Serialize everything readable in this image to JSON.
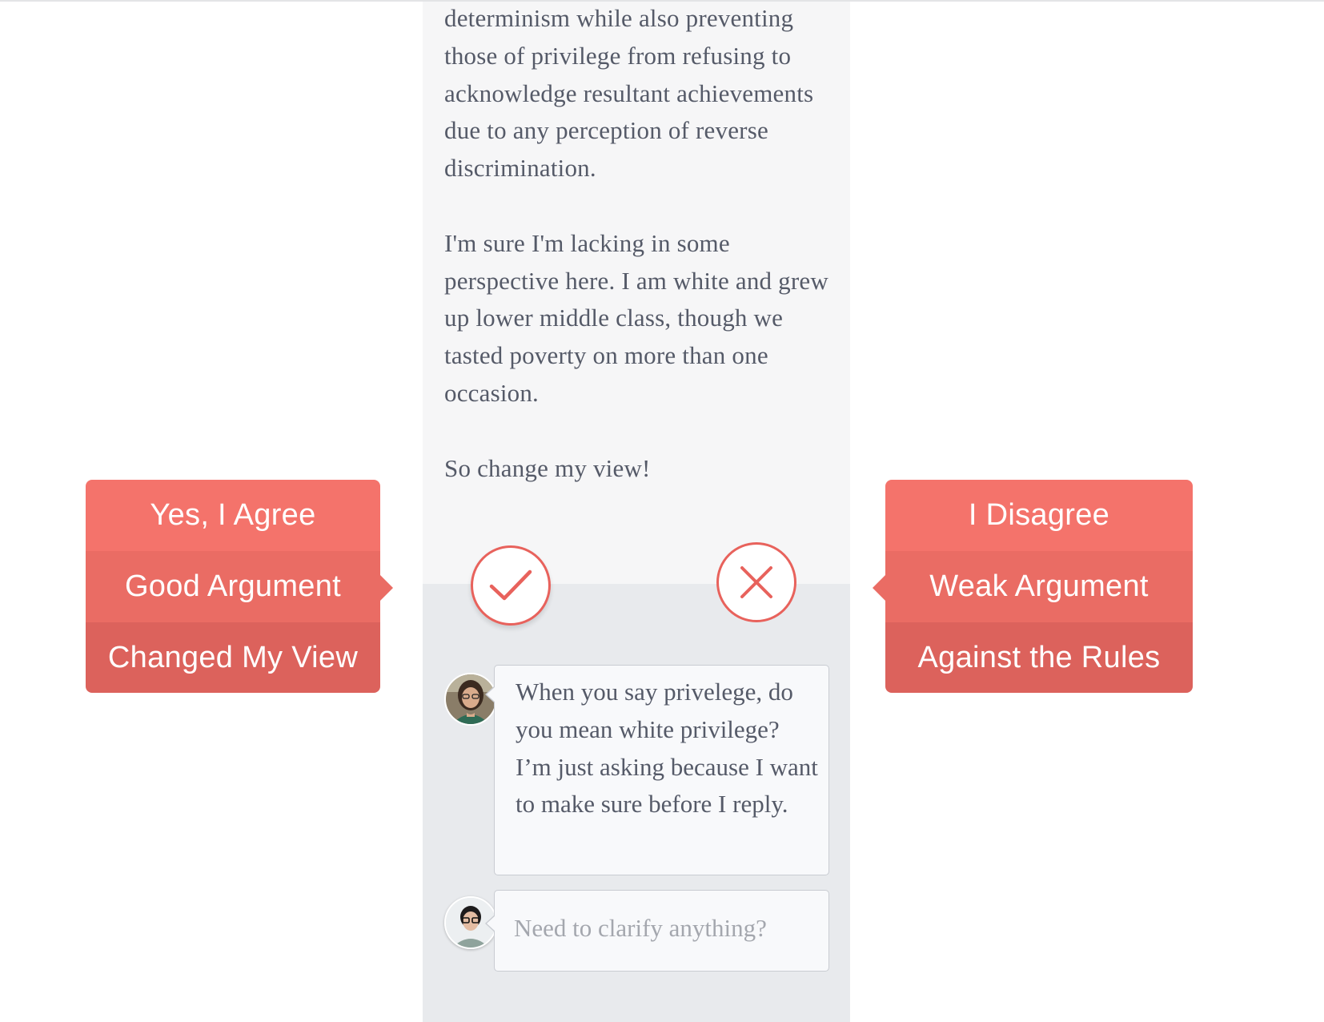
{
  "post": {
    "paragraphs": [
      "determinism while also preventing those of privilege from refusing to acknowledge resultant achievements due to any perception of reverse discrimination.",
      "I'm sure I'm lacking in some perspective here. I am white and grew up lower middle class, though we tasted poverty on more than one occasion.",
      "So change my view!"
    ]
  },
  "vote": {
    "agree_icon": "checkmark-icon",
    "disagree_icon": "x-icon",
    "accent_color": "#e8625c"
  },
  "agree_menu": {
    "items": [
      "Yes, I Agree",
      "Good Argument",
      "Changed My View"
    ]
  },
  "disagree_menu": {
    "items": [
      "I Disagree",
      "Weak Argument",
      "Against the Rules"
    ]
  },
  "comments": [
    {
      "avatar": "commenter-avatar",
      "text": "When you say privelege, do you mean white privilege? I’m just asking because I want to make sure before I reply."
    }
  ],
  "reply": {
    "avatar": "current-user-avatar",
    "placeholder": "Need to clarify anything?"
  },
  "colors": {
    "menu_top": "#f4736b",
    "menu_mid": "#ea6c64",
    "menu_bottom": "#dc625c",
    "post_bg": "#f6f6f7",
    "thread_bg": "#e8eaed",
    "text": "#555a68"
  }
}
